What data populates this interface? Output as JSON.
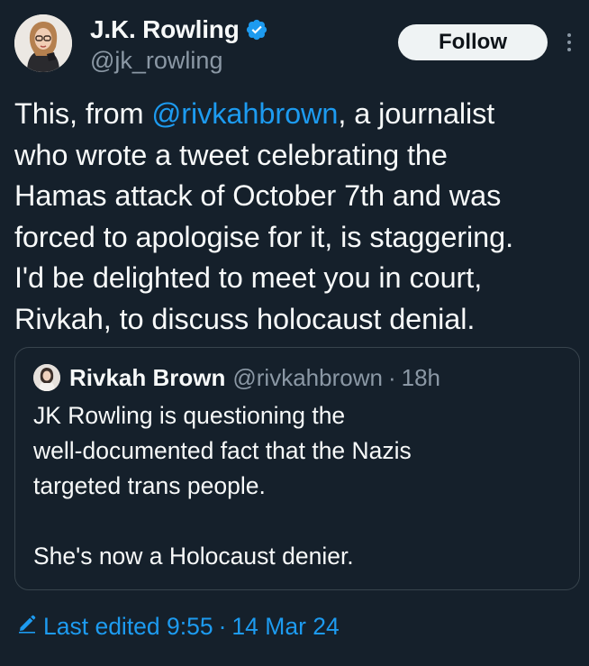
{
  "author": {
    "display_name": "J.K. Rowling",
    "handle": "@jk_rowling",
    "verified": true
  },
  "actions": {
    "follow_label": "Follow",
    "more_icon": "more-vertical-icon"
  },
  "tweet": {
    "lines": [
      {
        "before": "This, from ",
        "mention": "@rivkahbrown",
        "after": ", a journalist"
      },
      {
        "text": "who wrote a tweet celebrating the"
      },
      {
        "text": "Hamas attack of October 7th and was"
      },
      {
        "text": "forced to apologise for it, is staggering."
      },
      {
        "text": "I'd be delighted to meet you in court,"
      },
      {
        "text": "Rivkah, to discuss holocaust denial."
      }
    ]
  },
  "quoted_tweet": {
    "display_name": "Rivkah Brown",
    "handle": "@rivkahbrown",
    "separator": "·",
    "time": "18h",
    "lines": [
      "JK Rowling is questioning the",
      "well-documented fact that the Nazis",
      "targeted trans people.",
      "",
      "She's now a Holocaust denier."
    ]
  },
  "edit_info": {
    "label": "Last edited 9:55",
    "separator": "·",
    "date": "14 Mar 24",
    "icon": "pencil-icon"
  },
  "colors": {
    "background": "#15202b",
    "text": "#f7f9f9",
    "secondary": "#8b98a5",
    "accent": "#1d9bf0",
    "border": "#38444d",
    "follow_bg": "#eff3f4"
  }
}
